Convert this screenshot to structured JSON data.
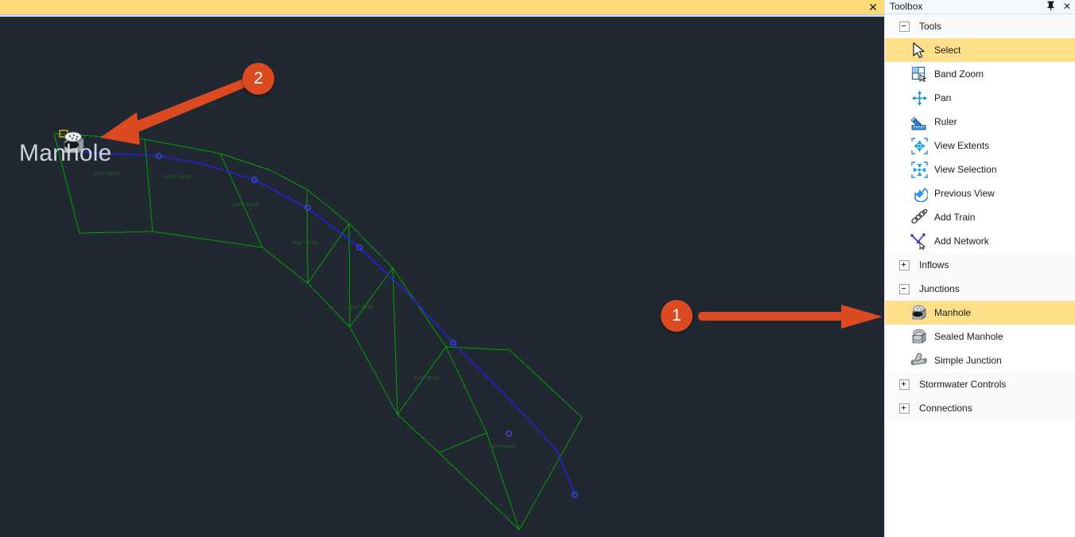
{
  "document_tab": {
    "close_label": "✕"
  },
  "canvas": {
    "cursor_tool_label": "Manhole",
    "background_color": "#222832",
    "network_line_color": "#2222dd",
    "catchment_color": "#00a000"
  },
  "annotations": [
    {
      "id": "callout-1",
      "number": "1",
      "target": "manhole-tool-item"
    },
    {
      "id": "callout-2",
      "number": "2",
      "target": "canvas-manhole-placement"
    }
  ],
  "toolbox": {
    "title": "Toolbox",
    "pin_icon_label": "📌",
    "close_label": "✕",
    "accent_selected_color": "#ffdf8a",
    "groups": [
      {
        "name": "Tools",
        "label": "Tools",
        "expanded": true,
        "items": [
          {
            "label": "Select",
            "icon": "cursor-arrow-icon",
            "selected": true
          },
          {
            "label": "Band Zoom",
            "icon": "band-zoom-icon",
            "selected": false
          },
          {
            "label": "Pan",
            "icon": "pan-icon",
            "selected": false
          },
          {
            "label": "Ruler",
            "icon": "ruler-icon",
            "selected": false
          },
          {
            "label": "View Extents",
            "icon": "view-extents-icon",
            "selected": false
          },
          {
            "label": "View Selection",
            "icon": "view-selection-icon",
            "selected": false
          },
          {
            "label": "Previous View",
            "icon": "previous-view-icon",
            "selected": false
          },
          {
            "label": "Add Train",
            "icon": "add-train-icon",
            "selected": false
          },
          {
            "label": "Add Network",
            "icon": "add-network-icon",
            "selected": false
          }
        ]
      },
      {
        "name": "Inflows",
        "label": "Inflows",
        "expanded": false,
        "items": []
      },
      {
        "name": "Junctions",
        "label": "Junctions",
        "expanded": true,
        "items": [
          {
            "label": "Manhole",
            "icon": "manhole-icon",
            "selected": true
          },
          {
            "label": "Sealed Manhole",
            "icon": "sealed-manhole-icon",
            "selected": false
          },
          {
            "label": "Simple Junction",
            "icon": "simple-junction-icon",
            "selected": false
          }
        ]
      },
      {
        "name": "Stormwater Controls",
        "label": "Stormwater Controls",
        "expanded": false,
        "items": []
      },
      {
        "name": "Connections",
        "label": "Connections",
        "expanded": false,
        "items": []
      }
    ]
  }
}
